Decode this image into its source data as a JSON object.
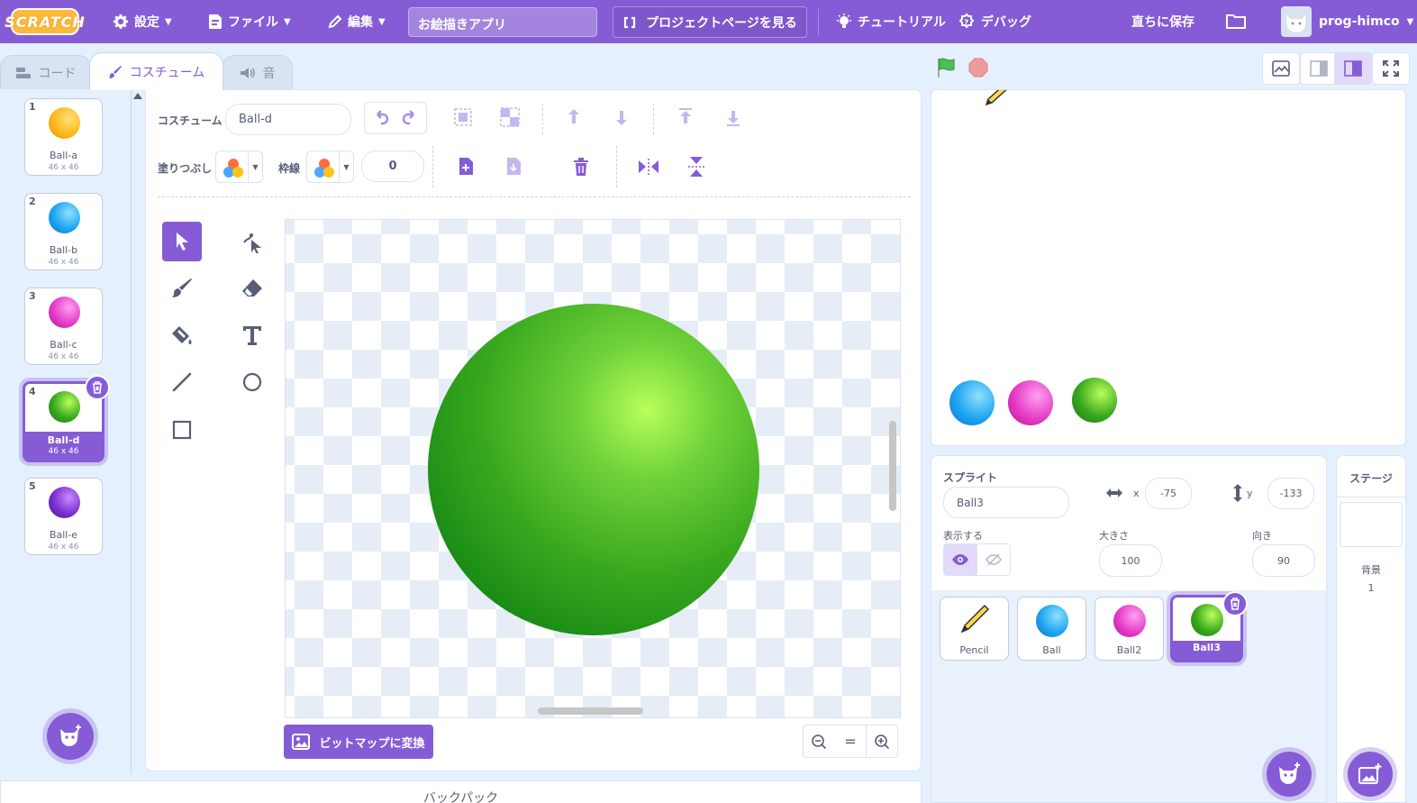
{
  "menu": {
    "logo": "SCRATCH",
    "settings": "設定",
    "file": "ファイル",
    "edit": "編集",
    "project_title": "お絵描きアプリ",
    "project_page": "プロジェクトページを見る",
    "tutorial": "チュートリアル",
    "debug": "デバッグ",
    "save_now": "直ちに保存",
    "username": "prog-himco"
  },
  "tabs": {
    "code": "コード",
    "costume": "コスチューム",
    "sound": "音"
  },
  "costumes": [
    {
      "num": "1",
      "name": "Ball-a",
      "size": "46 x 46",
      "color": "#ffb81c"
    },
    {
      "num": "2",
      "name": "Ball-b",
      "size": "46 x 46",
      "color": "#1fa5f0"
    },
    {
      "num": "3",
      "name": "Ball-c",
      "size": "46 x 46",
      "color": "#e63cc8"
    },
    {
      "num": "4",
      "name": "Ball-d",
      "size": "46 x 46",
      "color": "#3aa81e"
    },
    {
      "num": "5",
      "name": "Ball-e",
      "size": "46 x 46",
      "color": "#7b2fd0"
    }
  ],
  "editor": {
    "costume_label": "コスチューム",
    "costume_name": "Ball-d",
    "fill_label": "塗りつぶし",
    "outline_label": "枠線",
    "outline_width": "0",
    "convert_bitmap": "ビットマップに変換",
    "zoom_reset": "="
  },
  "sprite": {
    "label": "スプライト",
    "name": "Ball3",
    "x_label": "x",
    "x": "-75",
    "y_label": "y",
    "y": "-133",
    "show_label": "表示する",
    "size_label": "大きさ",
    "size": "100",
    "direction_label": "向き",
    "direction": "90"
  },
  "sprites": [
    {
      "name": "Pencil"
    },
    {
      "name": "Ball",
      "color": "#1fa5f0"
    },
    {
      "name": "Ball2",
      "color": "#e63cc8"
    },
    {
      "name": "Ball3",
      "color": "#3aa81e"
    }
  ],
  "stage_panel": {
    "title": "ステージ",
    "backdrop_label": "背景",
    "backdrop_count": "1"
  },
  "backpack": "バックパック",
  "colors": {
    "accent": "#855cd6",
    "bg": "#e5f0ff",
    "ball_green": "#3aa81e"
  }
}
